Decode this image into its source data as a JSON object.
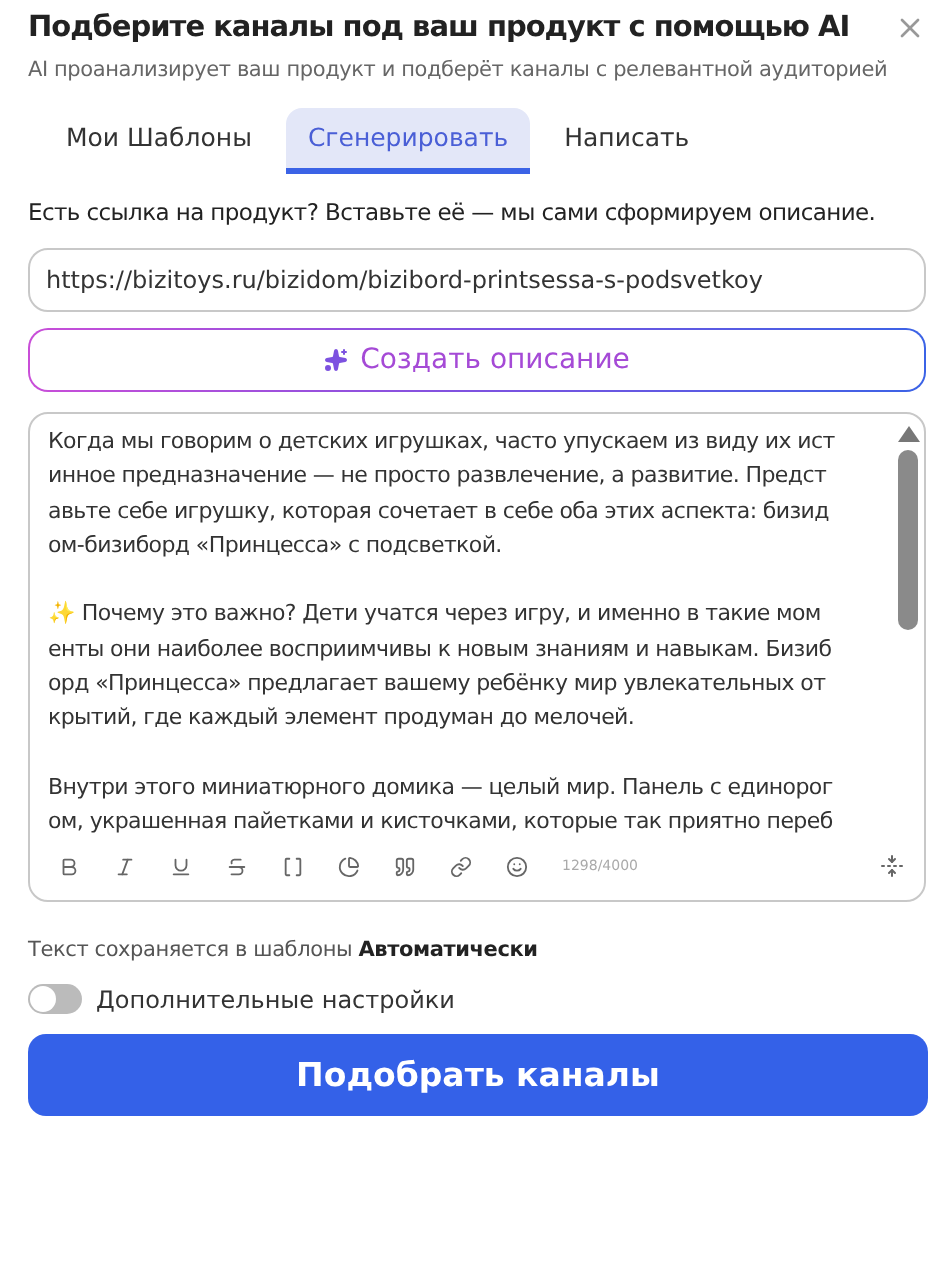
{
  "dialog": {
    "title": "Подберите каналы под ваш продукт с помощью AI",
    "subtitle": "AI проанализирует ваш продукт и подберёт каналы с релевантной аудиторией"
  },
  "tabs": [
    {
      "label": "Мои Шаблоны",
      "selected": false
    },
    {
      "label": "Сгенерировать",
      "selected": true
    },
    {
      "label": "Написать",
      "selected": false
    }
  ],
  "hint": "Есть ссылка на продукт? Вставьте её — мы сами сформируем описание.",
  "url_field": {
    "value": "https://bizitoys.ru/bizidom/bizibord-printsessa-s-podsvetkoy"
  },
  "create_button": "Создать описание",
  "editor": {
    "paragraphs": [
      [
        "Когда мы говорим о детских игрушках, часто упускаем из виду их ист",
        "инное предназначение — не просто развлечение, а развитие. Предст",
        "авьте себе игрушку, которая сочетает в себе оба этих аспекта: бизид",
        "ом-бизиборд «Принцесса» с подсветкой."
      ],
      [
        "✨ Почему это важно? Дети учатся через игру, и именно в такие мом",
        "енты они наиболее восприимчивы к новым знаниям и навыкам. Бизиб",
        "орд «Принцесса» предлагает вашему ребёнку мир увлекательных от",
        "крытий, где каждый элемент продуман до мелочей."
      ],
      [
        "Внутри этого миниатюрного домика — целый мир. Панель с единорог",
        "ом, украшенная пайетками и кисточками, которые так приятно переб"
      ]
    ],
    "counter": "1298/4000"
  },
  "autosave_note": "Текст сохраняется в шаблоны **Автоматически**",
  "advanced_toggle": {
    "label": "Дополнительные настройки",
    "on": false
  },
  "submit_button": "Подобрать каналы"
}
